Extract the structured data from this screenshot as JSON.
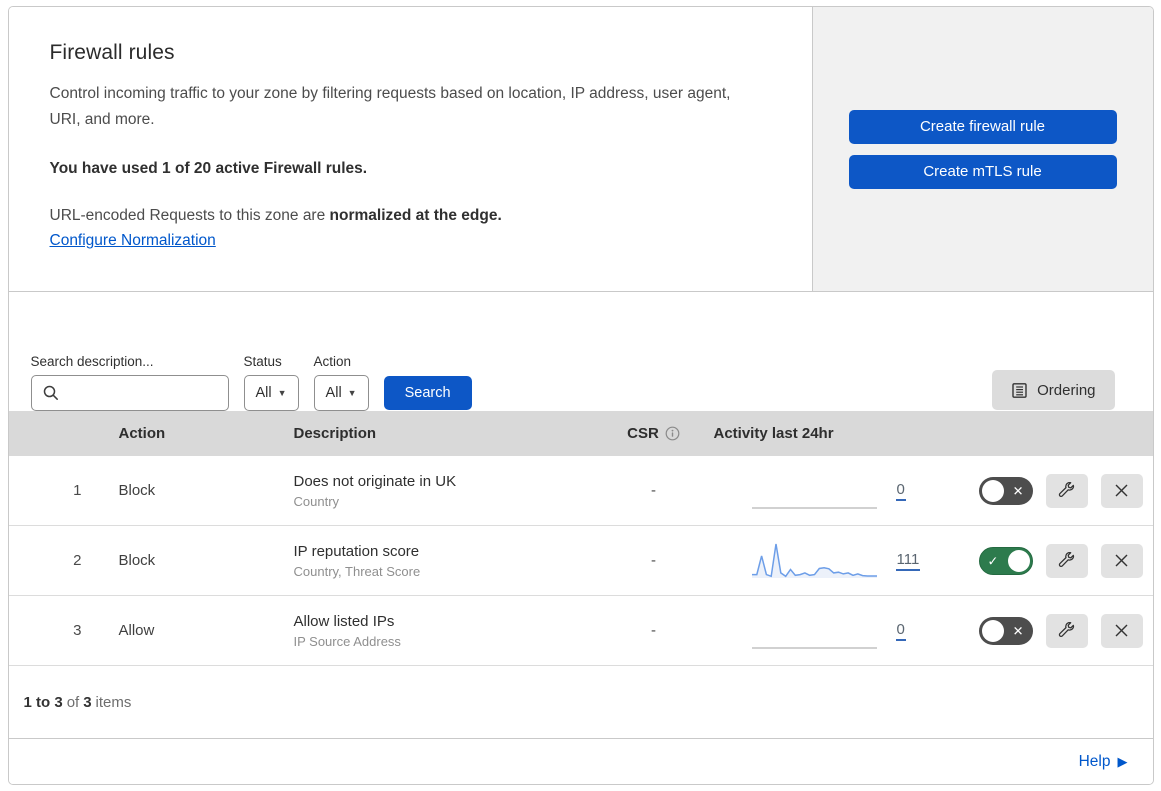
{
  "header": {
    "title": "Firewall rules",
    "description": "Control incoming traffic to your zone by filtering requests based on location, IP address, user agent, URI, and more.",
    "usage": "You have used 1 of 20 active Firewall rules.",
    "normalization_prefix": "URL-encoded Requests to this zone are ",
    "normalization_bold": "normalized at the edge.",
    "normalization_link": "Configure Normalization",
    "create_firewall_button": "Create firewall rule",
    "create_mtls_button": "Create mTLS rule"
  },
  "filters": {
    "search_label": "Search description...",
    "status_label": "Status",
    "status_value": "All",
    "action_label": "Action",
    "action_value": "All",
    "search_button": "Search",
    "ordering_button": "Ordering"
  },
  "table": {
    "columns": {
      "action": "Action",
      "description": "Description",
      "csr": "CSR",
      "activity": "Activity last 24hr"
    },
    "rows": [
      {
        "index": "1",
        "action": "Block",
        "title": "Does not originate in UK",
        "subtitle": "Country",
        "csr": "-",
        "activity_count": "0",
        "enabled": false,
        "sparkline": [
          0,
          0,
          0,
          0,
          0,
          0,
          0,
          0,
          0,
          0,
          0,
          0,
          0,
          0,
          0,
          0,
          0,
          0,
          0,
          0,
          0,
          0,
          0,
          0,
          0,
          0,
          0
        ]
      },
      {
        "index": "2",
        "action": "Block",
        "title": "IP reputation score",
        "subtitle": "Country, Threat Score",
        "csr": "-",
        "activity_count": "111",
        "enabled": true,
        "sparkline": [
          1,
          1,
          6.5,
          1,
          0.5,
          10,
          1.5,
          0.5,
          2.5,
          0.8,
          1,
          1.5,
          0.8,
          1,
          2.8,
          3,
          2.7,
          1.5,
          1.7,
          1.2,
          1.5,
          0.8,
          1.2,
          0.7,
          0.6,
          0.6,
          0.6
        ]
      },
      {
        "index": "3",
        "action": "Allow",
        "title": "Allow listed IPs",
        "subtitle": "IP Source Address",
        "csr": "-",
        "activity_count": "0",
        "enabled": false,
        "sparkline": [
          0,
          0,
          0,
          0,
          0,
          0,
          0,
          0,
          0,
          0,
          0,
          0,
          0,
          0,
          0,
          0,
          0,
          0,
          0,
          0,
          0,
          0,
          0,
          0,
          0,
          0,
          0
        ]
      }
    ]
  },
  "footer": {
    "range": "1 to 3",
    "of_text": "of",
    "total": "3",
    "items_text": "items",
    "help": "Help"
  },
  "colors": {
    "accent_blue": "#0d57c6",
    "link_blue": "#0057cb",
    "toggle_on_green": "#2d7b4d",
    "toggle_off_gray": "#4d4d4d",
    "spark_line": "#6d9ee8",
    "spark_fill": "rgba(125,163,224,0.15)",
    "spark_flat": "#c2c2c2",
    "table_header_bg": "#d9d9d9"
  }
}
